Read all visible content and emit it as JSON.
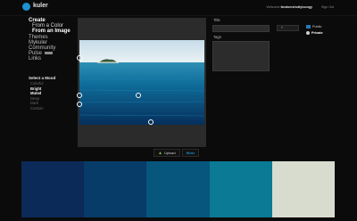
{
  "app": {
    "name": "kuler"
  },
  "header": {
    "welcome_prefix": "Welcome",
    "user": "fandomshottyloungy",
    "sign_out": "Sign Out"
  },
  "nav": {
    "create": "Create",
    "from_color": "From a Color",
    "from_image": "From an Image",
    "themes": "Themes",
    "mykuler": "Mykuler",
    "community": "Community",
    "pulse": "Pulse",
    "links": "Links"
  },
  "mood": {
    "title": "Select a Mood",
    "options": [
      "Colorful",
      "Bright",
      "Muted",
      "Deep",
      "Dark",
      "Custom"
    ],
    "selected": [
      "Bright",
      "Muted"
    ]
  },
  "canvas": {
    "upload_label": "Upload",
    "flickr_label": "flickr"
  },
  "form": {
    "title_label": "Title",
    "title_value": "",
    "tags_label": "Tags",
    "tags_value": "",
    "chip_label": "",
    "public_label": "Public",
    "private_label": "Private"
  },
  "palette": {
    "colors": [
      "#0b2a57",
      "#073c68",
      "#06567d",
      "#0a7a95",
      "#d8dccf"
    ]
  },
  "colors": {
    "accent": "#1f8fd0",
    "upload_arrow": "#7ac043"
  }
}
